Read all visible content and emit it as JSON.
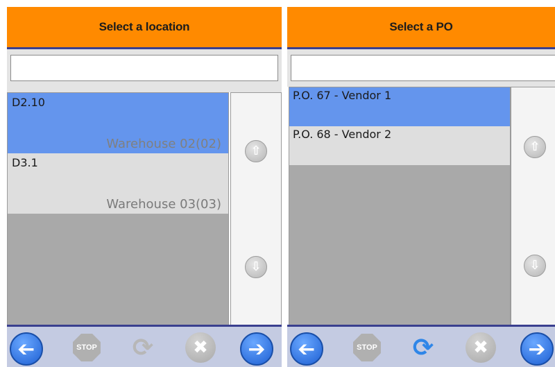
{
  "left_panel": {
    "title": "Select a location",
    "search": {
      "value": "",
      "placeholder": ""
    },
    "items": [
      {
        "code": "D2.10",
        "warehouse": "Warehouse 02(02)",
        "selected": true
      },
      {
        "code": "D3.1",
        "warehouse": "Warehouse 03(03)",
        "selected": false
      }
    ],
    "scroll_up_icon": "arrow-up-circle",
    "scroll_down_icon": "arrow-down-circle",
    "toolbar": {
      "back_icon": "arrow-left-circle",
      "stop_label": "STOP",
      "refresh_icon": "refresh",
      "cancel_icon": "x-circle",
      "forward_icon": "arrow-right-circle"
    }
  },
  "right_panel": {
    "title": "Select a PO",
    "search": {
      "value": "",
      "placeholder": ""
    },
    "items": [
      {
        "label": "P.O. 67 - Vendor 1",
        "selected": true
      },
      {
        "label": "P.O. 68 - Vendor 2",
        "selected": false
      }
    ],
    "scroll_up_icon": "arrow-up-circle",
    "scroll_down_icon": "arrow-down-circle",
    "toolbar": {
      "back_icon": "arrow-left-circle",
      "stop_label": "STOP",
      "refresh_icon": "refresh",
      "cancel_icon": "x-circle",
      "forward_icon": "arrow-right-circle"
    }
  },
  "colors": {
    "header": "#ff8a00",
    "header_border": "#3a3f8f",
    "selected_row": "#6495ed",
    "normal_row": "#dedede",
    "list_background": "#a9a9a9",
    "toolbar": "#c4cbe2",
    "primary_button": "#1d5fd3",
    "refresh_active": "#2f86e8"
  }
}
